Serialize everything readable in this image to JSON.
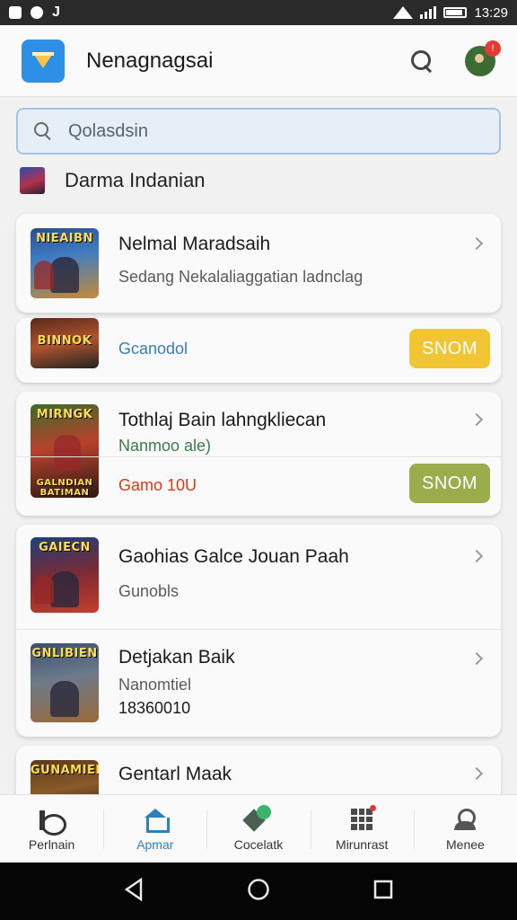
{
  "status_bar": {
    "time": "13:29",
    "left_icons": [
      "notification-icon",
      "face-icon",
      "j-icon"
    ]
  },
  "app_bar": {
    "title": "Nenagnagsai",
    "search_icon": "search-icon",
    "avatar_badge": "!"
  },
  "search": {
    "placeholder": "Qolasdsin"
  },
  "section": {
    "label": "Darma Indanian"
  },
  "items": [
    {
      "cover_text": "NIEAIBN",
      "title": "Nelmal Maradsaih",
      "subtitle": "Sedang Nekalaliaggatian ladnclag"
    },
    {
      "cover_text": "BINNOK",
      "subtitle": "Gcanodol",
      "button": "SNOM"
    },
    {
      "cover_text": "MIRNGK",
      "cover_text_2": "GALNDIAN BATIMAN",
      "title": "Tothlaj Bain lahngkliecan",
      "subtitle": "Nanmoo ale)",
      "price": "Gamo 10U",
      "button": "SNOM"
    },
    {
      "cover_text": "GAIECN",
      "title": "Gaohias Galce Jouan Paah",
      "subtitle": "Gunobls"
    },
    {
      "cover_text": "GNLIBIEN",
      "title": "Detjakan Baik",
      "subtitle": "Nanomtiel",
      "extra": "18360010"
    },
    {
      "cover_text": "GUNAMIEKI",
      "title": "Gentarl Maak"
    }
  ],
  "bottom_nav": [
    {
      "label": "Perlnain",
      "icon": "home-icon"
    },
    {
      "label": "Apmar",
      "icon": "store-icon",
      "active": true
    },
    {
      "label": "Cocelatk",
      "icon": "chat-icon"
    },
    {
      "label": "Mirunrast",
      "icon": "grid-icon"
    },
    {
      "label": "Menee",
      "icon": "person-icon"
    }
  ],
  "colors": {
    "accent": "#2f7fb8",
    "button_yellow": "#f2c535",
    "button_green": "#9aac4c",
    "price_red": "#d9391b",
    "subtitle_blue": "#3b7db5",
    "subtitle_green": "#3b7a4d"
  }
}
